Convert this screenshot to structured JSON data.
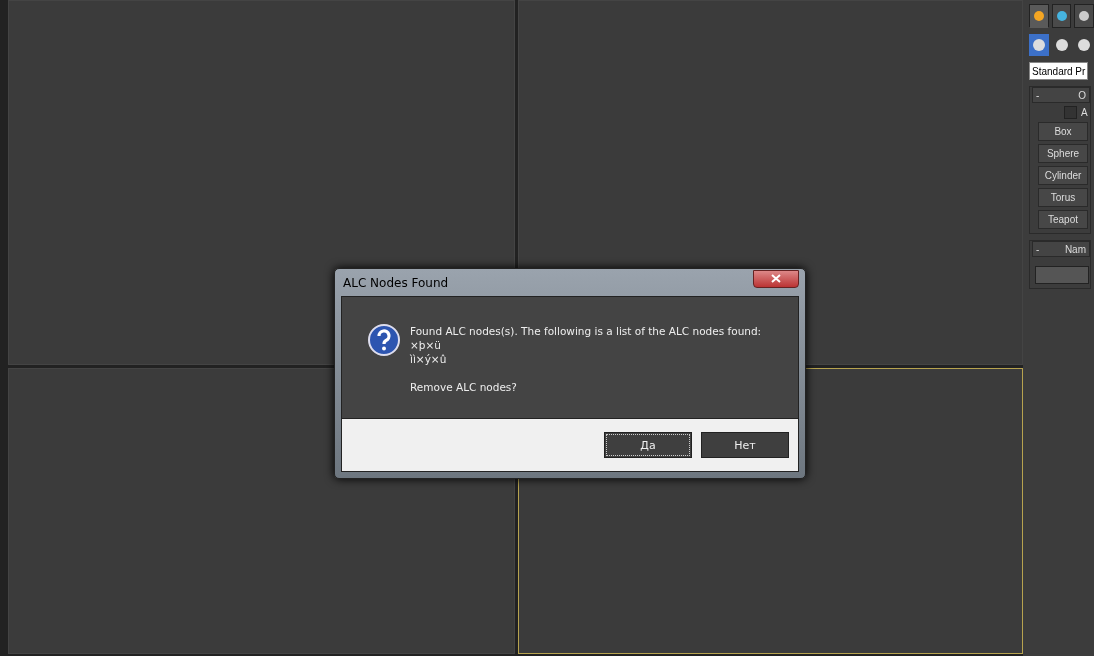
{
  "viewports": [
    {
      "active": false
    },
    {
      "active": false
    },
    {
      "active": false
    },
    {
      "active": true
    }
  ],
  "command_panel": {
    "tabs": [
      {
        "selected": true
      },
      {
        "selected": false
      },
      {
        "selected": false
      }
    ],
    "subtypes": [
      {
        "selected": true
      },
      {
        "selected": false
      },
      {
        "selected": false
      }
    ],
    "category_dropdown": {
      "value": "Standard Pr"
    },
    "rollouts": [
      {
        "sign": "-",
        "title": "O",
        "checkbox": {
          "label": "A",
          "checked": false
        },
        "buttons": [
          "Box",
          "Sphere",
          "Cylinder",
          "Torus",
          "Teapot"
        ]
      },
      {
        "sign": "-",
        "title": "Nam",
        "field": true
      }
    ]
  },
  "dialog": {
    "title": "ALC Nodes Found",
    "message": "Found ALC nodes(s). The following is a list of the ALC nodes found:",
    "nodes": [
      "×þ×ü",
      "ìì×ý×û"
    ],
    "question": "Remove ALC nodes?",
    "buttons": [
      {
        "label": "Да",
        "default": true
      },
      {
        "label": "Нет",
        "default": false
      }
    ]
  }
}
